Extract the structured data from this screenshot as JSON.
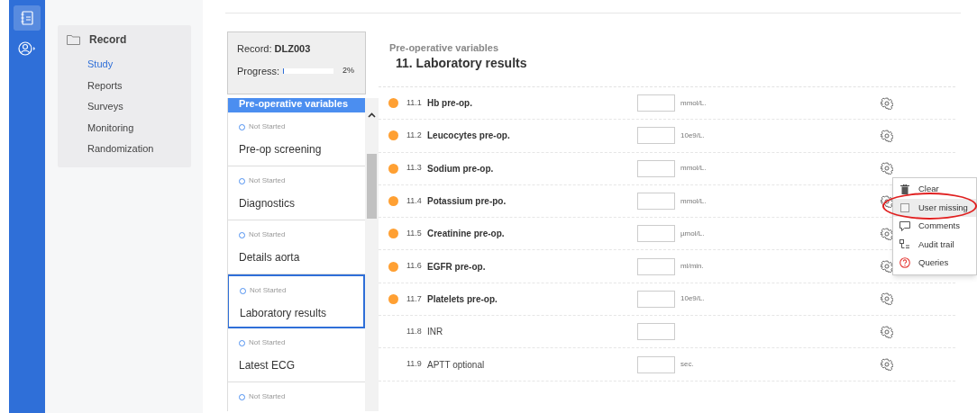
{
  "nav_rail": {
    "items": [
      {
        "kind": "record",
        "selected": true
      },
      {
        "kind": "user",
        "selected": false
      }
    ]
  },
  "sidebar": {
    "title": "Record",
    "items": [
      {
        "label": "Study",
        "selected": true
      },
      {
        "label": "Reports",
        "selected": false
      },
      {
        "label": "Surveys",
        "selected": false
      },
      {
        "label": "Monitoring",
        "selected": false
      },
      {
        "label": "Randomization",
        "selected": false
      }
    ]
  },
  "record_card": {
    "label": "Record:",
    "record_id": "DLZ003",
    "progress_label": "Progress:",
    "level": 0.02,
    "reading": "2%"
  },
  "steps": {
    "header": "Pre-operative variables",
    "items": [
      {
        "status": "Not Started",
        "label": "Pre-op screening",
        "selected": false
      },
      {
        "status": "Not Started",
        "label": "Diagnostics",
        "selected": false
      },
      {
        "status": "Not Started",
        "label": "Details aorta",
        "selected": false
      },
      {
        "status": "Not Started",
        "label": "Laboratory results",
        "selected": true
      },
      {
        "status": "Not Started",
        "label": "Latest ECG",
        "selected": false
      },
      {
        "status": "Not Started",
        "selected": false
      }
    ]
  },
  "form": {
    "section": "Pre-operative variables",
    "title": "11. Laboratory results",
    "fields": [
      {
        "number": "11.1",
        "label": "Hb pre-op.",
        "required": true,
        "unit": "mmol/L."
      },
      {
        "number": "11.2",
        "label": "Leucocytes pre-op.",
        "required": true,
        "unit": "10e9/L."
      },
      {
        "number": "11.3",
        "label": "Sodium pre-op.",
        "required": true,
        "unit": "mmol/L."
      },
      {
        "number": "11.4",
        "label": "Potassium pre-po.",
        "required": true,
        "unit": "mmol/L."
      },
      {
        "number": "11.5",
        "label": "Creatinine pre-op.",
        "required": true,
        "unit": "µmol/L."
      },
      {
        "number": "11.6",
        "label": "EGFR pre-op.",
        "required": true,
        "unit": "ml/min."
      },
      {
        "number": "11.7",
        "label": "Platelets pre-op.",
        "required": true,
        "unit": "10e9/L."
      },
      {
        "number": "11.8",
        "label": "INR",
        "required": false
      },
      {
        "number": "11.9",
        "label": "APTT optional",
        "required": false,
        "unit": "sec."
      }
    ]
  },
  "context_menu": {
    "items": [
      {
        "kind": "trash",
        "label": "Clear"
      },
      {
        "kind": "checkbox",
        "label": "User missing",
        "checked": false,
        "highlighted": true
      },
      {
        "kind": "comment",
        "label": "Comments"
      },
      {
        "kind": "audit",
        "label": "Audit trail"
      },
      {
        "kind": "question",
        "label": "Queries"
      }
    ]
  }
}
